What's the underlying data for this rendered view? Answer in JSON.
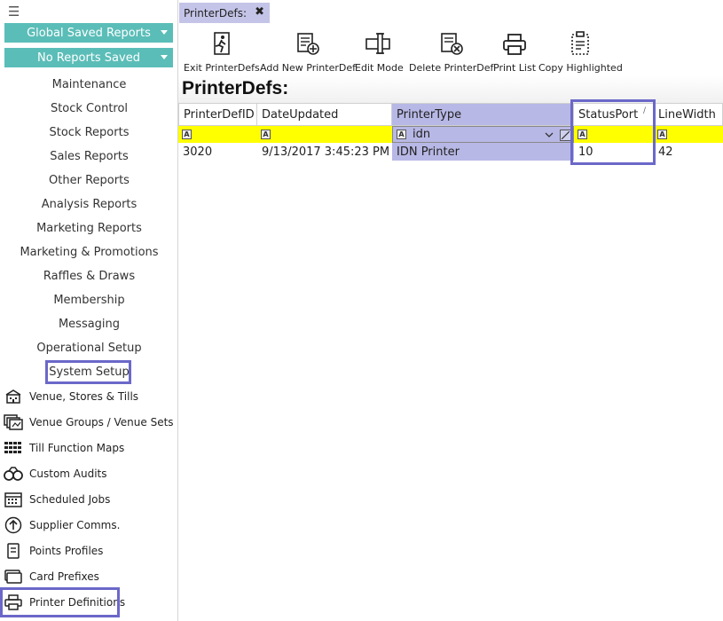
{
  "sidebar": {
    "saved_reports": "Global Saved Reports",
    "no_reports": "No Reports Saved",
    "menu": [
      "Maintenance",
      "Stock Control",
      "Stock Reports",
      "Sales Reports",
      "Other Reports",
      "Analysis Reports",
      "Marketing Reports",
      "Marketing & Promotions",
      "Raffles & Draws",
      "Membership",
      "Messaging",
      "Operational Setup",
      "System Setup"
    ],
    "sub_items": [
      {
        "label": "Venue, Stores & Tills",
        "icon": "venue-icon"
      },
      {
        "label": "Venue Groups / Venue Sets",
        "icon": "venue-groups-icon"
      },
      {
        "label": "Till Function Maps",
        "icon": "grid-icon"
      },
      {
        "label": "Custom Audits",
        "icon": "handcuffs-icon"
      },
      {
        "label": "Scheduled Jobs",
        "icon": "calendar-icon"
      },
      {
        "label": "Supplier Comms.",
        "icon": "upload-circle-icon"
      },
      {
        "label": "Points Profiles",
        "icon": "document-icon"
      },
      {
        "label": "Card Prefixes",
        "icon": "cards-icon"
      },
      {
        "label": "Printer Definitions",
        "icon": "printer-icon"
      }
    ]
  },
  "tab": {
    "label": "PrinterDefs:",
    "close": "✖"
  },
  "toolbar": {
    "exit": "Exit PrinterDefs",
    "add": "Add New PrinterDef",
    "edit": "Edit Mode",
    "delete": "Delete PrinterDef",
    "print": "Print List",
    "copy": "Copy Highlighted"
  },
  "page": {
    "title": "PrinterDefs:"
  },
  "grid": {
    "headers": [
      "PrinterDefID",
      "DateUpdated",
      "PrinterType",
      "StatusPort",
      "LineWidth"
    ],
    "filter_value": "idn",
    "filter_glyph": "A",
    "row": [
      "3020",
      "9/13/2017 3:45:23 PM",
      "IDN Printer",
      "10",
      "42"
    ]
  },
  "colors": {
    "accent": "#5bbdb8",
    "highlight": "#6b68c9",
    "selected_col": "#b8b8e6",
    "filter_row": "#ffff00"
  }
}
